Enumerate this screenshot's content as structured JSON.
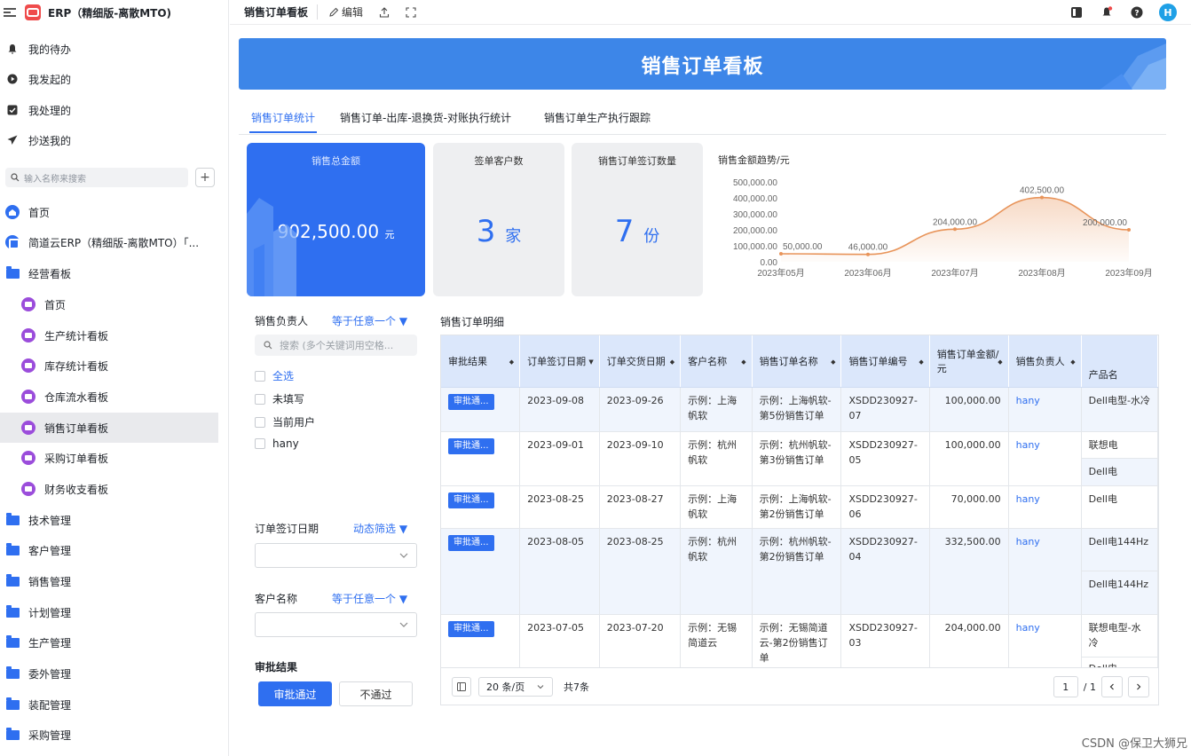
{
  "app": {
    "title": "ERP（精细版-离散MTO)"
  },
  "sidebar": {
    "quick": [
      {
        "label": "我的待办",
        "icon": "bell-icon"
      },
      {
        "label": "我发起的",
        "icon": "play-circle-icon"
      },
      {
        "label": "我处理的",
        "icon": "check-box-icon"
      },
      {
        "label": "抄送我的",
        "icon": "send-icon"
      }
    ],
    "search_placeholder": "输入名称来搜索",
    "plus_label": "+",
    "nav": [
      {
        "label": "首页",
        "icon": "home-icon"
      },
      {
        "label": "简道云ERP（精细版-离散MTO）「...",
        "icon": "app-icon"
      },
      {
        "label": "经营看板",
        "icon": "folder-icon"
      }
    ],
    "board_items": [
      {
        "label": "首页"
      },
      {
        "label": "生产统计看板"
      },
      {
        "label": "库存统计看板"
      },
      {
        "label": "仓库流水看板"
      },
      {
        "label": "销售订单看板"
      },
      {
        "label": "采购订单看板"
      },
      {
        "label": "财务收支看板"
      }
    ],
    "folders": [
      {
        "label": "技术管理"
      },
      {
        "label": "客户管理"
      },
      {
        "label": "销售管理"
      },
      {
        "label": "计划管理"
      },
      {
        "label": "生产管理"
      },
      {
        "label": "委外管理"
      },
      {
        "label": "装配管理"
      },
      {
        "label": "采购管理"
      }
    ]
  },
  "topbar": {
    "title": "销售订单看板",
    "edit_label": "编辑",
    "share_icon": "upload-icon",
    "fullscreen_icon": "fullscreen-icon",
    "avatar": "H"
  },
  "banner": {
    "title": "销售订单看板"
  },
  "tabs": [
    {
      "label": "销售订单统计",
      "active": true
    },
    {
      "label": "销售订单-出库-退换货-对账执行统计"
    },
    {
      "label": "销售订单生产执行跟踪"
    }
  ],
  "kpi": {
    "total": {
      "label": "销售总金额",
      "value": "902,500.00",
      "unit": "元"
    },
    "customers": {
      "label": "签单客户数",
      "value": "3",
      "unit": "家"
    },
    "orders": {
      "label": "销售订单签订数量",
      "value": "7",
      "unit": "份"
    }
  },
  "chart_data": {
    "type": "area",
    "title": "销售金额趋势/元",
    "categories": [
      "2023年05月",
      "2023年06月",
      "2023年07月",
      "2023年08月",
      "2023年09月"
    ],
    "values": [
      50000,
      46000,
      204000,
      402500,
      200000
    ],
    "value_labels": [
      "50,000.00",
      "46,000.00",
      "204,000.00",
      "402,500.00",
      "200,000.00"
    ],
    "y_ticks": [
      "500,000.00",
      "400,000.00",
      "300,000.00",
      "200,000.00",
      "100,000.00",
      "0.00"
    ],
    "ylim": [
      0,
      500000
    ],
    "color": "#e8945a"
  },
  "filters": {
    "owner": {
      "label": "销售负责人",
      "mode": "等于任意一个 ▼",
      "search_placeholder": "搜索 (多个关键词用空格...",
      "options": [
        "全选",
        "未填写",
        "当前用户",
        "hany"
      ]
    },
    "sign_date": {
      "label": "订单签订日期",
      "mode": "动态筛选 ▼"
    },
    "customer": {
      "label": "客户名称",
      "mode": "等于任意一个 ▼"
    },
    "approval": {
      "label": "审批结果",
      "pass": "审批通过",
      "fail": "不通过"
    }
  },
  "table": {
    "title": "销售订单明细",
    "columns": [
      "审批结果",
      "订单签订日期",
      "订单交货日期",
      "客户名称",
      "销售订单名称",
      "销售订单编号",
      "销售订单金额/元",
      "销售负责人",
      "产品名"
    ],
    "rows": [
      {
        "status": "审批通...",
        "sign": "2023-09-08",
        "deliver": "2023-09-26",
        "customer": "示例：上海帆软",
        "name": "示例：上海帆软-第5份销售订单",
        "code": "XSDD230927-07",
        "amount": "100,000.00",
        "owner": "hany",
        "products": [
          "Dell电型-水冷"
        ]
      },
      {
        "status": "审批通...",
        "sign": "2023-09-01",
        "deliver": "2023-09-10",
        "customer": "示例：杭州帆软",
        "name": "示例：杭州帆软-第3份销售订单",
        "code": "XSDD230927-05",
        "amount": "100,000.00",
        "owner": "hany",
        "products": [
          "联想电",
          "Dell电"
        ]
      },
      {
        "status": "审批通...",
        "sign": "2023-08-25",
        "deliver": "2023-08-27",
        "customer": "示例：上海帆软",
        "name": "示例：上海帆软-第2份销售订单",
        "code": "XSDD230927-06",
        "amount": "70,000.00",
        "owner": "hany",
        "products": [
          "Dell电"
        ]
      },
      {
        "status": "审批通...",
        "sign": "2023-08-05",
        "deliver": "2023-08-25",
        "customer": "示例：杭州帆软",
        "name": "示例：杭州帆软-第2份销售订单",
        "code": "XSDD230927-04",
        "amount": "332,500.00",
        "owner": "hany",
        "products": [
          "Dell电144Hz",
          "Dell电144Hz"
        ]
      },
      {
        "status": "审批通...",
        "sign": "2023-07-05",
        "deliver": "2023-07-20",
        "customer": "示例：无锡简道云",
        "name": "示例：无锡简道云-第2份销售订单",
        "code": "XSDD230927-03",
        "amount": "204,000.00",
        "owner": "hany",
        "products": [
          "联想电型-水冷",
          "Dell电"
        ]
      }
    ]
  },
  "pager": {
    "size": "20 条/页",
    "total": "共7条",
    "page": "1",
    "pages": "/ 1"
  },
  "watermark": "CSDN @保卫大狮兄"
}
